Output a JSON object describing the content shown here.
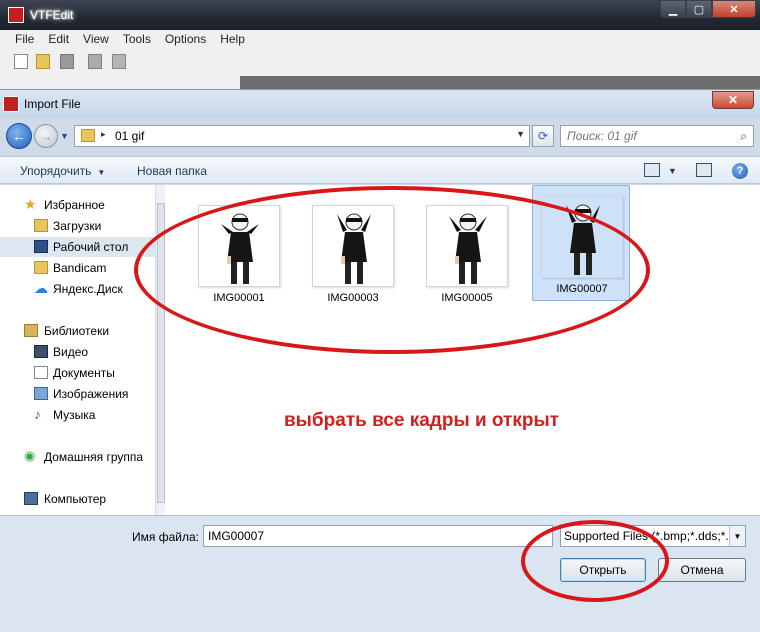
{
  "vtf_window": {
    "title": "VTFEdit",
    "menu": [
      "File",
      "Edit",
      "View",
      "Tools",
      "Options",
      "Help"
    ]
  },
  "dialog": {
    "title": "Import File",
    "close_label": "✕",
    "address": {
      "path_sep": "▸",
      "path": "01 gif"
    },
    "search": {
      "placeholder": "Поиск: 01 gif"
    },
    "commands": {
      "organize": "Упорядочить",
      "new_folder": "Новая папка",
      "help": "?"
    },
    "nav": {
      "favorites": "Избранное",
      "downloads": "Загрузки",
      "desktop": "Рабочий стол",
      "bandicam": "Bandicam",
      "yandex_disk": "Яндекс.Диск",
      "libraries": "Библиотеки",
      "video": "Видео",
      "documents": "Документы",
      "images": "Изображения",
      "music": "Музыка",
      "homegroup": "Домашняя группа",
      "computer": "Компьютер"
    },
    "files": [
      "IMG00001",
      "IMG00003",
      "IMG00005",
      "IMG00007"
    ],
    "selected_file": "IMG00007",
    "filename_label": "Имя файла:",
    "filename_value": "IMG00007",
    "filter_value": "Supported Files (*.bmp;*.dds;*.g",
    "open_button": "Открыть",
    "cancel_button": "Отмена"
  },
  "annotation": {
    "text": "выбрать все кадры и открыт",
    "color": "#d02020"
  }
}
